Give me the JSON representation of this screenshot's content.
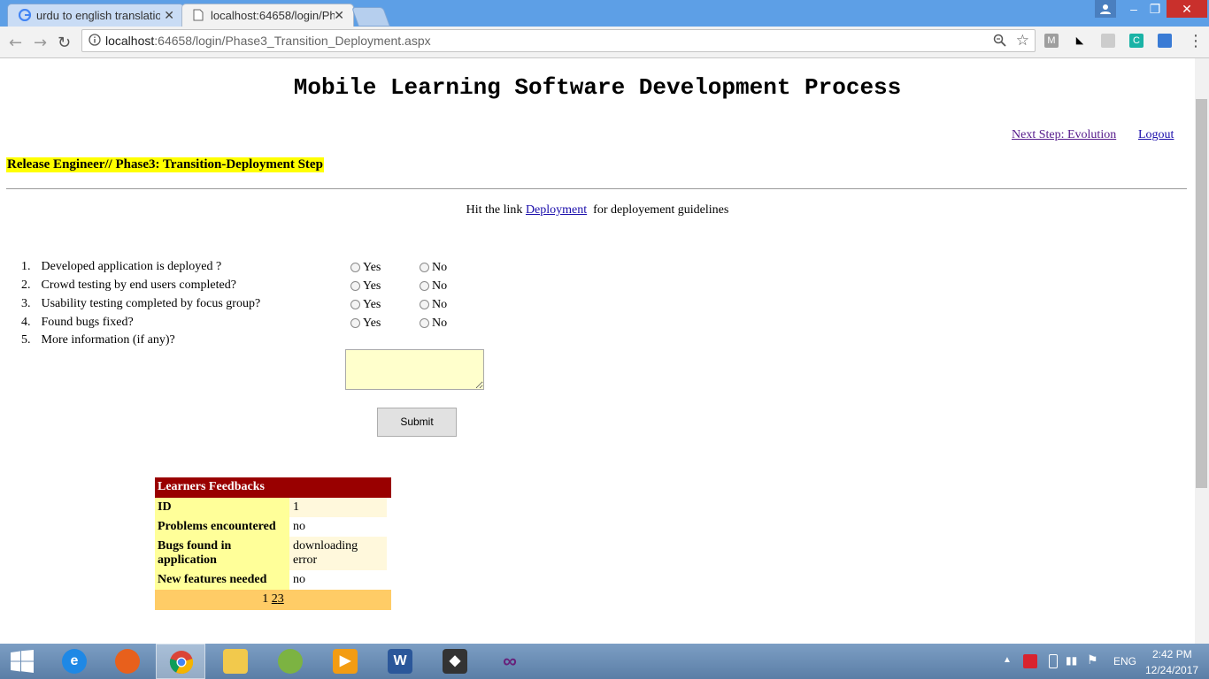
{
  "browser": {
    "tabs": [
      {
        "title": "urdu to english translatio",
        "icon": "google-icon"
      },
      {
        "title": "localhost:64658/login/Ph",
        "icon": "page-icon"
      }
    ],
    "close_glyph": "✕",
    "url_host": "localhost",
    "url_path": ":64658/login/Phase3_Transition_Deployment.aspx",
    "extensions": [
      "M",
      "C"
    ]
  },
  "page": {
    "title": "Mobile Learning Software Development Process",
    "next_step_link": "Next Step: Evolution",
    "logout_link": "Logout",
    "role_heading": "Release Engineer// Phase3: Transition-Deployment Step",
    "hint_prefix": "Hit the link",
    "hint_link": "Deployment",
    "hint_suffix": "for deployement guidelines",
    "questions": [
      {
        "num": "1.",
        "text": "Developed application is deployed ?",
        "yes": "Yes",
        "no": "No"
      },
      {
        "num": "2.",
        "text": "Crowd testing by end users completed?",
        "yes": "Yes",
        "no": "No"
      },
      {
        "num": "3.",
        "text": "Usability testing completed by focus group?",
        "yes": "Yes",
        "no": "No"
      },
      {
        "num": "4.",
        "text": "Found bugs fixed?",
        "yes": "Yes",
        "no": "No"
      },
      {
        "num": "5.",
        "text": "More information (if any)?"
      }
    ],
    "more_info_value": "",
    "submit_label": "Submit"
  },
  "feedback": {
    "header": "Learners Feedbacks",
    "rows": [
      {
        "key": "ID",
        "value": "1"
      },
      {
        "key": "Problems encountered",
        "value": "no"
      },
      {
        "key": "Bugs found in application",
        "value": "downloading error"
      },
      {
        "key": "New features needed",
        "value": "no"
      }
    ],
    "pager": {
      "current": "1",
      "pages": [
        "2",
        "3"
      ]
    }
  },
  "taskbar": {
    "lang": "ENG",
    "time": "2:42 PM",
    "date": "12/24/2017"
  },
  "colors": {
    "heading_highlight": "#ffff00",
    "feedback_header": "#990000",
    "feedback_key_bg": "#ffff99",
    "feedback_pager_bg": "#ffcc66",
    "textarea_bg": "#ffffcc"
  }
}
